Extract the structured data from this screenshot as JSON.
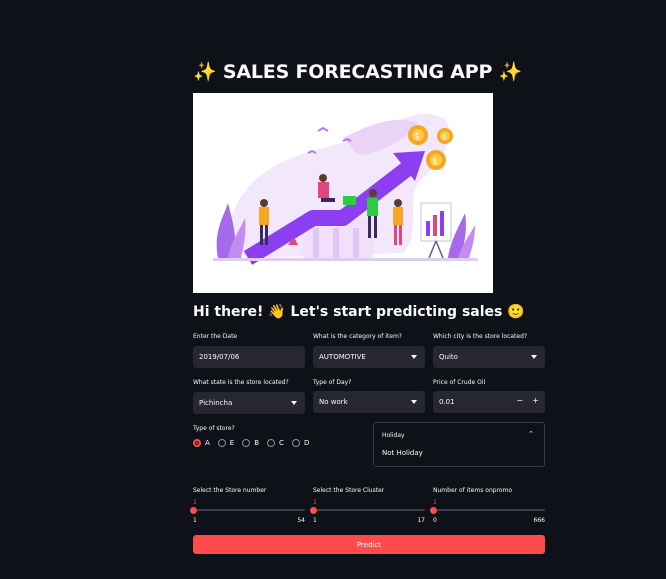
{
  "app": {
    "title": "SALES FORECASTING APP",
    "title_emoji": "✨",
    "greeting": "Hi there! 👋 Let's start predicting sales 🙂"
  },
  "form": {
    "date": {
      "label": "Enter the Date",
      "value": "2019/07/06"
    },
    "category": {
      "label": "What is the category of item?",
      "value": "AUTOMOTIVE"
    },
    "city": {
      "label": "Which city is the store located?",
      "value": "Quito"
    },
    "state": {
      "label": "What state is the store located?",
      "value": "Pichincha"
    },
    "day_type": {
      "label": "Type of Day?",
      "value": "No work"
    },
    "oil": {
      "label": "Price of Crude Oil",
      "value": "0.01",
      "minus": "−",
      "plus": "+"
    },
    "store_type": {
      "label": "Type of store?",
      "options": [
        "A",
        "E",
        "B",
        "C",
        "D"
      ],
      "selected": "A"
    },
    "holiday": {
      "label": "Holiday",
      "value": "Not Holiday"
    },
    "store_number": {
      "label": "Select the Store number",
      "value": "1",
      "min": "1",
      "max": "54",
      "fraction": 0
    },
    "store_cluster": {
      "label": "Select the Store Cluster",
      "value": "1",
      "min": "1",
      "max": "17",
      "fraction": 0
    },
    "onpromo": {
      "label": "Number of items onpromo",
      "value": "1",
      "min": "0",
      "max": "666",
      "fraction": 0.0015
    }
  },
  "predict_label": "Predict",
  "colors": {
    "accent": "#ff4b4b",
    "background": "#0e1117",
    "input": "#262730",
    "illustration_purple": "#8b3ff0"
  }
}
